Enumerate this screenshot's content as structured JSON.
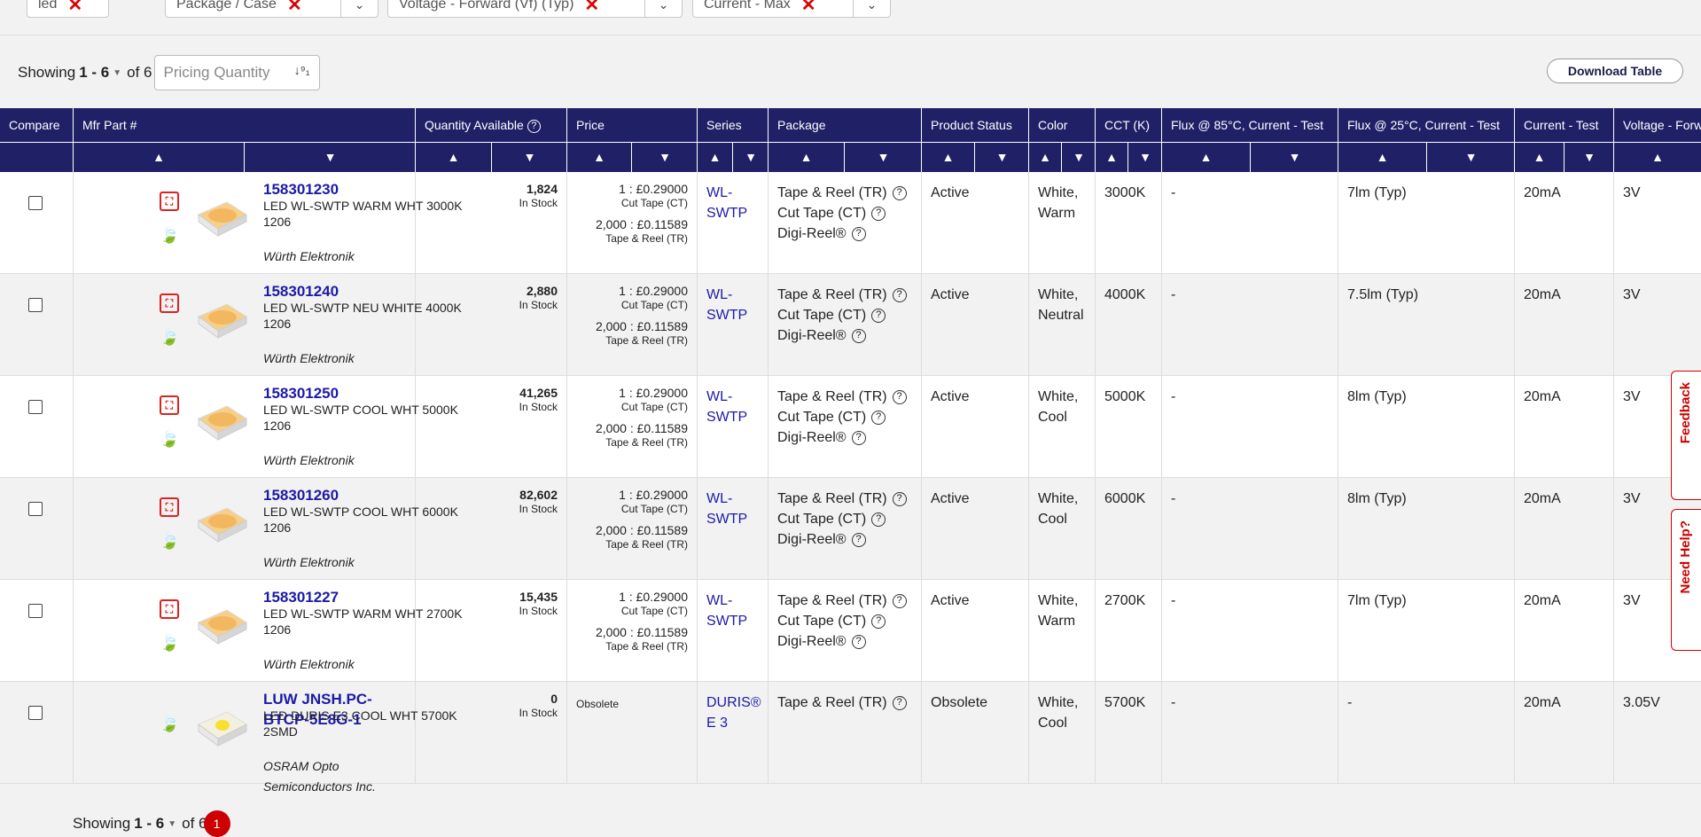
{
  "filters": [
    {
      "label": "led",
      "removable": true,
      "dropdown": false
    },
    {
      "label": "Package / Case",
      "removable": true,
      "dropdown": true
    },
    {
      "label": "Voltage - Forward (Vf) (Typ)",
      "removable": true,
      "dropdown": true
    },
    {
      "label": "Current - Max",
      "removable": true,
      "dropdown": true
    }
  ],
  "showing": {
    "prefix": "Showing",
    "range": "1 - 6",
    "of_label": "of 6",
    "pricing_placeholder": "Pricing Quantity"
  },
  "download_label": "Download Table",
  "columns": [
    "Compare",
    "Mfr Part #",
    "Quantity Available",
    "Price",
    "Series",
    "Package",
    "Product Status",
    "Color",
    "CCT (K)",
    "Flux @ 85°C, Current - Test",
    "Flux @ 25°C, Current - Test",
    "Current - Test",
    "Voltage - Forward"
  ],
  "sort_up": "▲",
  "sort_down": "▼",
  "rows": [
    {
      "part": "158301230",
      "desc": "LED WL-SWTP WARM WHT 3000K 1206",
      "mfr": "Würth Elektronik",
      "pdf": true,
      "qty": "1,824",
      "stock": "In Stock",
      "p1": "1 : £0.29000",
      "p1pack": "Cut Tape (CT)",
      "p2": "2,000 : £0.11589",
      "p2pack": "Tape & Reel (TR)",
      "series": "WL-SWTP",
      "pkg": [
        "Tape & Reel (TR)",
        "Cut Tape (CT)",
        "Digi-Reel®"
      ],
      "status": "Active",
      "color": "White, Warm",
      "cct": "3000K",
      "flux85": "-",
      "flux25": "7lm (Typ)",
      "current": "20mA",
      "voltage": "3V"
    },
    {
      "part": "158301240",
      "desc": "LED WL-SWTP NEU WHITE 4000K 1206",
      "mfr": "Würth Elektronik",
      "pdf": true,
      "qty": "2,880",
      "stock": "In Stock",
      "p1": "1 : £0.29000",
      "p1pack": "Cut Tape (CT)",
      "p2": "2,000 : £0.11589",
      "p2pack": "Tape & Reel (TR)",
      "series": "WL-SWTP",
      "pkg": [
        "Tape & Reel (TR)",
        "Cut Tape (CT)",
        "Digi-Reel®"
      ],
      "status": "Active",
      "color": "White, Neutral",
      "cct": "4000K",
      "flux85": "-",
      "flux25": "7.5lm (Typ)",
      "current": "20mA",
      "voltage": "3V"
    },
    {
      "part": "158301250",
      "desc": "LED WL-SWTP COOL WHT 5000K 1206",
      "mfr": "Würth Elektronik",
      "pdf": true,
      "qty": "41,265",
      "stock": "In Stock",
      "p1": "1 : £0.29000",
      "p1pack": "Cut Tape (CT)",
      "p2": "2,000 : £0.11589",
      "p2pack": "Tape & Reel (TR)",
      "series": "WL-SWTP",
      "pkg": [
        "Tape & Reel (TR)",
        "Cut Tape (CT)",
        "Digi-Reel®"
      ],
      "status": "Active",
      "color": "White, Cool",
      "cct": "5000K",
      "flux85": "-",
      "flux25": "8lm (Typ)",
      "current": "20mA",
      "voltage": "3V"
    },
    {
      "part": "158301260",
      "desc": "LED WL-SWTP COOL WHT 6000K 1206",
      "mfr": "Würth Elektronik",
      "pdf": true,
      "qty": "82,602",
      "stock": "In Stock",
      "p1": "1 : £0.29000",
      "p1pack": "Cut Tape (CT)",
      "p2": "2,000 : £0.11589",
      "p2pack": "Tape & Reel (TR)",
      "series": "WL-SWTP",
      "pkg": [
        "Tape & Reel (TR)",
        "Cut Tape (CT)",
        "Digi-Reel®"
      ],
      "status": "Active",
      "color": "White, Cool",
      "cct": "6000K",
      "flux85": "-",
      "flux25": "8lm (Typ)",
      "current": "20mA",
      "voltage": "3V"
    },
    {
      "part": "158301227",
      "desc": "LED WL-SWTP WARM WHT 2700K 1206",
      "mfr": "Würth Elektronik",
      "pdf": true,
      "qty": "15,435",
      "stock": "In Stock",
      "p1": "1 : £0.29000",
      "p1pack": "Cut Tape (CT)",
      "p2": "2,000 : £0.11589",
      "p2pack": "Tape & Reel (TR)",
      "series": "WL-SWTP",
      "pkg": [
        "Tape & Reel (TR)",
        "Cut Tape (CT)",
        "Digi-Reel®"
      ],
      "status": "Active",
      "color": "White, Warm",
      "cct": "2700K",
      "flux85": "-",
      "flux25": "7lm (Typ)",
      "current": "20mA",
      "voltage": "3V"
    },
    {
      "part": "LUW JNSH.PC-BTCP-5E8G-1",
      "desc": "LED DURIS E3 COOL WHT 5700K 2SMD",
      "mfr": "OSRAM Opto Semiconductors Inc.",
      "pdf": false,
      "qty": "0",
      "stock": "In Stock",
      "obsolete_price": "Obsolete",
      "series": "DURIS® E 3",
      "pkg": [
        "Tape & Reel (TR)"
      ],
      "status": "Obsolete",
      "color": "White, Cool",
      "cct": "5700K",
      "flux85": "-",
      "flux25": "-",
      "current": "20mA",
      "voltage": "3.05V"
    }
  ],
  "side_buttons": {
    "feedback": "Feedback",
    "help": "Need Help?"
  },
  "bottom": {
    "prefix": "Showing",
    "range": "1 - 6",
    "of_label": "of 6",
    "badge": "1"
  },
  "colors": {
    "header_bg": "#1f2066",
    "link": "#1c1aa8",
    "accent_red": "#cc0000",
    "leaf_green": "#3a9a3a"
  },
  "icons": {
    "pdf": "datasheet-pdf-icon",
    "leaf": "rohs-leaf-icon",
    "help": "question-circle-icon",
    "sort": "sort-numeric-icon"
  }
}
